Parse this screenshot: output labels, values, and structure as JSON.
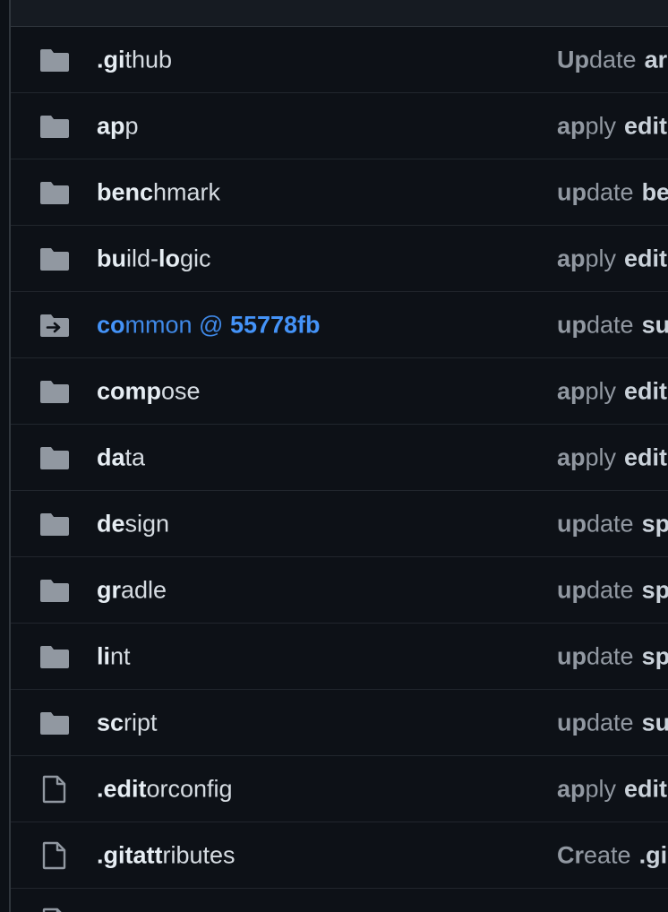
{
  "icons": {
    "folder": "folder-icon",
    "submodule": "submodule-icon",
    "file": "file-icon"
  },
  "colors": {
    "background": "#0d1117",
    "text": "#e6edf3",
    "muted": "#9198a1",
    "link": "#4493f8",
    "icon": "#9198a1"
  },
  "rows": [
    {
      "type": "folder",
      "name_a": ".gi",
      "name_b": "thub",
      "commit_a": "Up",
      "commit_b": "date",
      "commit_tail": "ar"
    },
    {
      "type": "folder",
      "name_a": "ap",
      "name_b": "p",
      "commit_a": "ap",
      "commit_b": "ply",
      "commit_tail": "edit"
    },
    {
      "type": "folder",
      "name_a": "benc",
      "name_b": "hmark",
      "commit_a": "up",
      "commit_b": "date",
      "commit_tail": "be"
    },
    {
      "type": "folder",
      "name_a": "bu",
      "name_b": "ild-",
      "name_c": "lo",
      "name_d": "gic",
      "commit_a": "ap",
      "commit_b": "ply",
      "commit_tail": "edit"
    },
    {
      "type": "submodule",
      "name_a": "co",
      "name_b": "mmon @ ",
      "name_c": "55778fb",
      "commit_a": "up",
      "commit_b": "date",
      "commit_tail": "su"
    },
    {
      "type": "folder",
      "name_a": "comp",
      "name_b": "ose",
      "commit_a": "ap",
      "commit_b": "ply",
      "commit_tail": "edit"
    },
    {
      "type": "folder",
      "name_a": "da",
      "name_b": "ta",
      "commit_a": "ap",
      "commit_b": "ply",
      "commit_tail": "edit"
    },
    {
      "type": "folder",
      "name_a": "de",
      "name_b": "sign",
      "commit_a": "up",
      "commit_b": "date",
      "commit_tail": "sp"
    },
    {
      "type": "folder",
      "name_a": "gr",
      "name_b": "adle",
      "commit_a": "up",
      "commit_b": "date",
      "commit_tail": "sp"
    },
    {
      "type": "folder",
      "name_a": "li",
      "name_b": "nt",
      "commit_a": "up",
      "commit_b": "date",
      "commit_tail": "sp"
    },
    {
      "type": "folder",
      "name_a": "sc",
      "name_b": "ript",
      "commit_a": "up",
      "commit_b": "date",
      "commit_tail": "su"
    },
    {
      "type": "file",
      "name_a": ".edit",
      "name_b": "orconfig",
      "commit_a": "ap",
      "commit_b": "ply",
      "commit_tail": "edit"
    },
    {
      "type": "file",
      "name_a": ".gitatt",
      "name_b": "ributes",
      "commit_a": "Cr",
      "commit_b": "eate",
      "commit_tail": ".gi"
    }
  ]
}
